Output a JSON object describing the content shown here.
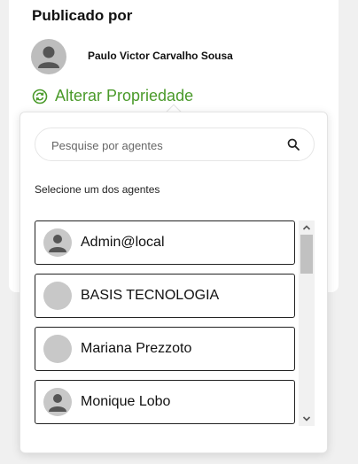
{
  "publisher": {
    "title": "Publicado por",
    "name": "Paulo Victor Carvalho Sousa",
    "avatar_icon": "user-silhouette-icon"
  },
  "change_owner": {
    "label": "Alterar Propriedade",
    "icon": "sync-icon",
    "color": "#4a9a2a"
  },
  "dropdown": {
    "search": {
      "placeholder": "Pesquise por agentes",
      "value": "",
      "icon": "search-icon"
    },
    "hint": "Selecione um dos agentes",
    "agents": [
      {
        "name": "Admin@local",
        "avatar": "user-silhouette-icon"
      },
      {
        "name": "BASIS TECNOLOGIA",
        "avatar": "blank-avatar"
      },
      {
        "name": "Mariana Prezzoto",
        "avatar": "blank-avatar"
      },
      {
        "name": "Monique Lobo",
        "avatar": "user-silhouette-icon"
      }
    ]
  }
}
